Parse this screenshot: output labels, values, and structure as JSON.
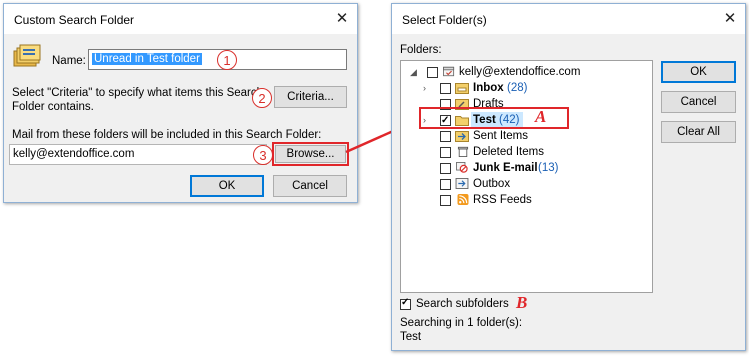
{
  "left_dialog": {
    "title": "Custom Search Folder",
    "close_glyph": "✕",
    "name_label": "Name:",
    "name_value": "Unread in Test folder",
    "criteria_text_line1": "Select \"Criteria\" to specify what items this Search",
    "criteria_text_line2": "Folder contains.",
    "criteria_button": "Criteria...",
    "mail_from_text": "Mail from these folders will be included in this Search Folder:",
    "mail_from_value": "kelly@extendoffice.com",
    "browse_button": "Browse...",
    "ok_button": "OK",
    "cancel_button": "Cancel"
  },
  "callouts": [
    "1",
    "2",
    "3"
  ],
  "letters": {
    "a": "A",
    "b": "B"
  },
  "right_dialog": {
    "title": "Select Folder(s)",
    "close_glyph": "✕",
    "folders_label": "Folders:",
    "tree": [
      {
        "label": "kelly@extendoffice.com",
        "count": "",
        "bold": false,
        "checked": false,
        "expander": "down",
        "icon": "account"
      },
      {
        "label": "Inbox",
        "count": "(28)",
        "bold": true,
        "checked": false,
        "expander": "right",
        "icon": "inbox"
      },
      {
        "label": "Drafts",
        "count": "",
        "bold": false,
        "checked": false,
        "expander": "",
        "icon": "drafts"
      },
      {
        "label": "Test",
        "count": "(42)",
        "bold": true,
        "checked": true,
        "expander": "right",
        "icon": "folder"
      },
      {
        "label": "Sent Items",
        "count": "",
        "bold": false,
        "checked": false,
        "expander": "",
        "icon": "sent"
      },
      {
        "label": "Deleted Items",
        "count": "",
        "bold": false,
        "checked": false,
        "expander": "",
        "icon": "deleted"
      },
      {
        "label": "Junk E-mail",
        "count": "(13)",
        "bold": true,
        "checked": false,
        "expander": "",
        "icon": "junk"
      },
      {
        "label": "Outbox",
        "count": "",
        "bold": false,
        "checked": false,
        "expander": "",
        "icon": "outbox"
      },
      {
        "label": "RSS Feeds",
        "count": "",
        "bold": false,
        "checked": false,
        "expander": "",
        "icon": "rss"
      }
    ],
    "ok_button": "OK",
    "cancel_button": "Cancel",
    "clear_all_button": "Clear All",
    "search_subfolders_label": "Search subfolders",
    "search_subfolders_checked": true,
    "searching_text": "Searching in 1 folder(s):",
    "searching_folder": "Test"
  }
}
